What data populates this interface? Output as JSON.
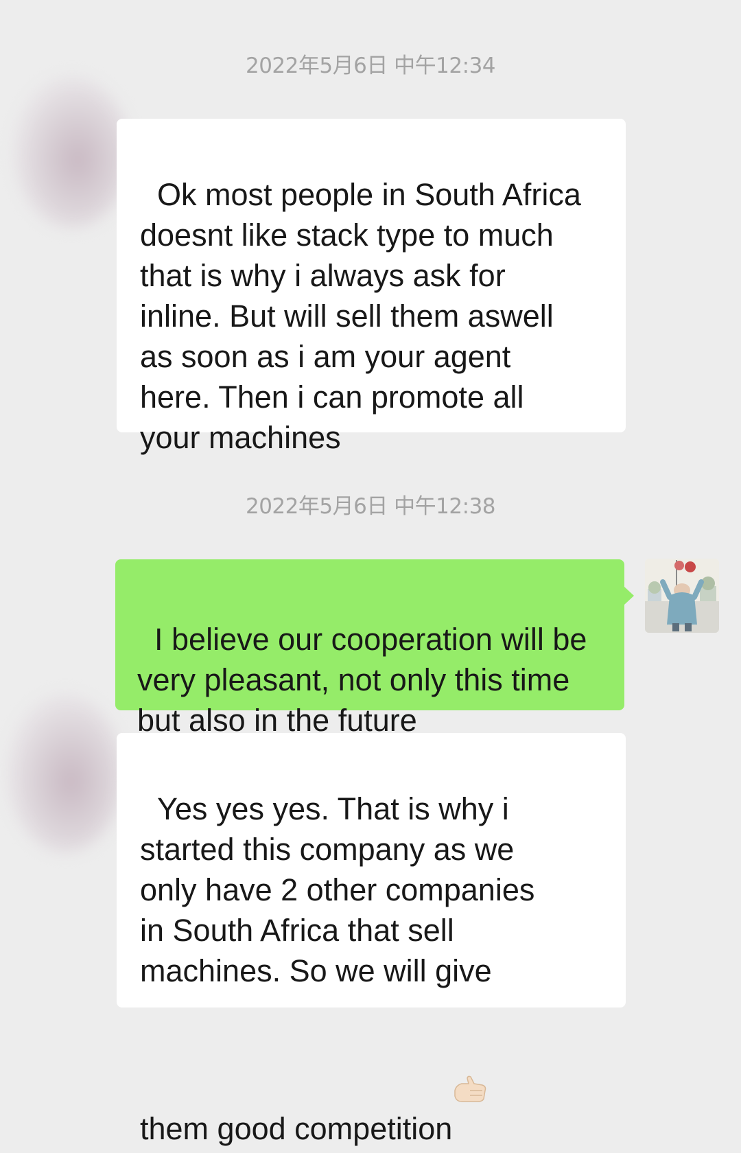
{
  "messages": [
    {
      "timestamp": "2022年5月6日 中午12:34",
      "text": "Ok most people in South Africa\ndoesnt like stack type to much\nthat is why i always ask for\ninline. But will sell them aswell\nas soon as i am your agent\nhere. Then i can promote all\nyour machines"
    },
    {
      "timestamp": "2022年5月6日 中午12:38",
      "text": "I believe our cooperation will be\nvery pleasant, not only this time\nbut also in the future"
    },
    {
      "text": "Yes yes yes. That is why i\nstarted this company as we\nonly have 2 other companies\nin South Africa that sell\nmachines. So we will give\nthem good competition",
      "emoji": "thumbs-up-emoji"
    }
  ],
  "colors": {
    "background": "#ededed",
    "incoming_bubble": "#ffffff",
    "outgoing_bubble": "#95ec69",
    "timestamp_text": "#a3a3a3",
    "message_text": "#181818"
  }
}
